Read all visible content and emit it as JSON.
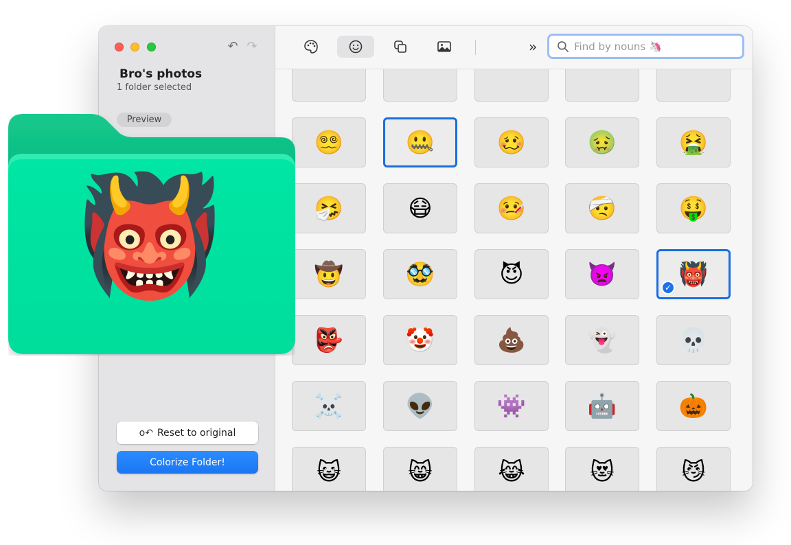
{
  "sidebar": {
    "title": "Bro's photos",
    "subtitle": "1 folder selected",
    "preview_label": "Preview",
    "reset_label": "Reset to original",
    "colorize_label": "Colorize Folder!",
    "folder_color": "#00e0a0",
    "folder_emoji": "👹"
  },
  "toolbar": {
    "tabs": [
      "palette",
      "emoji",
      "shapes",
      "image"
    ],
    "active_tab": "emoji",
    "more_label": "»",
    "search_placeholder": "Find by nouns 🦄"
  },
  "grid": {
    "rows": [
      [
        "😵‍💫",
        "🤐",
        "🥴",
        "🤢",
        "🤮"
      ],
      [
        "🤧",
        "😷",
        "🤒",
        "🤕",
        "🤑"
      ],
      [
        "🤠",
        "🥸",
        "😈",
        "👿",
        "👹"
      ],
      [
        "👺",
        "🤡",
        "💩",
        "👻",
        "💀"
      ],
      [
        "☠️",
        "👽",
        "👾",
        "🤖",
        "🎃"
      ],
      [
        "😺",
        "😸",
        "😹",
        "😻",
        "😼"
      ]
    ],
    "selected_emoji": "👹",
    "highlighted_emoji": "🤐"
  },
  "colors": {
    "accent": "#1a76f2",
    "folder": "#00e0a0"
  }
}
